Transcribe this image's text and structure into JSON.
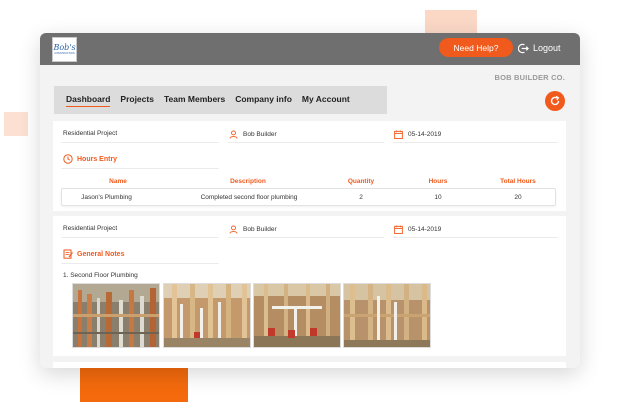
{
  "app": {
    "logo_text": "Bob's",
    "logo_subtext": "CONSTRUCTION",
    "company_name": "BOB BUILDER CO."
  },
  "header": {
    "help_label": "Need Help?",
    "logout_label": "Logout"
  },
  "tabs": [
    {
      "label": "Dashboard",
      "active": true
    },
    {
      "label": "Projects"
    },
    {
      "label": "Team Members"
    },
    {
      "label": "Company info"
    },
    {
      "label": "My Account"
    }
  ],
  "cards": [
    {
      "project": "Residential Project",
      "user": "Bob Builder",
      "date": "05-14-2019",
      "section_title": "Hours Entry",
      "columns": [
        "Name",
        "Description",
        "Quantity",
        "Hours",
        "Total Hours"
      ],
      "rows": [
        [
          "Jason's Plumbing",
          "Completed second floor plumbing",
          "2",
          "10",
          "20"
        ]
      ]
    },
    {
      "project": "Residential Project",
      "user": "Bob Builder",
      "date": "05-14-2019",
      "section_title": "General Notes",
      "note": "1. Second Floor Plumbing",
      "photo_count": 4
    }
  ],
  "colors": {
    "accent": "#f15a1d",
    "topbar": "#6f6f6f",
    "panel": "#f3f3f3"
  },
  "icons": [
    "refresh-icon",
    "logout-icon",
    "user-icon",
    "calendar-icon",
    "clock-icon",
    "notes-icon"
  ]
}
